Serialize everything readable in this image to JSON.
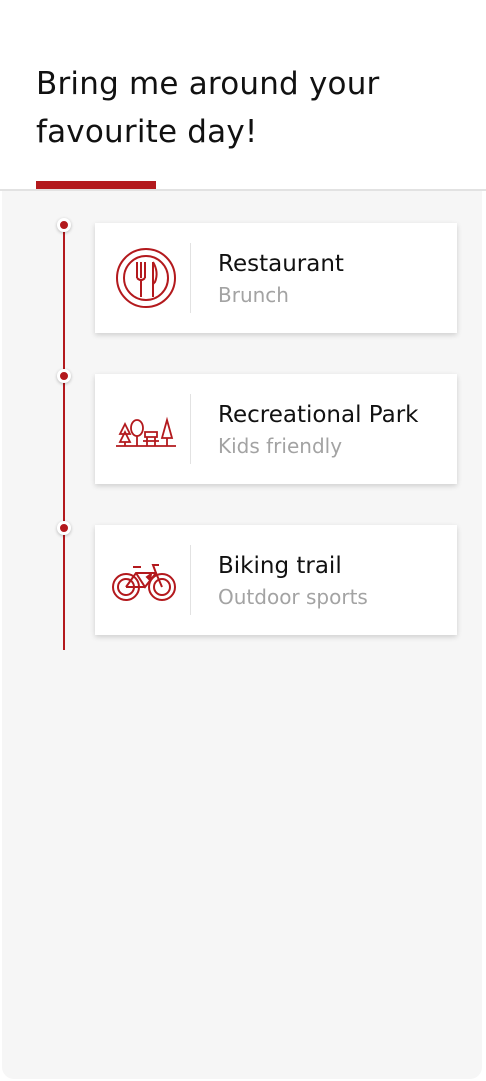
{
  "header": {
    "title": "Bring me around your\nfavourite day!"
  },
  "colors": {
    "accent": "#b3191d",
    "background": "#f6f6f6",
    "card": "#ffffff",
    "title_text": "#111111",
    "subtitle_text": "#a3a3a3"
  },
  "timeline": {
    "items": [
      {
        "icon": "restaurant-icon",
        "title": "Restaurant",
        "subtitle": "Brunch"
      },
      {
        "icon": "park-icon",
        "title": "Recreational Park",
        "subtitle": "Kids friendly"
      },
      {
        "icon": "bike-icon",
        "title": "Biking trail",
        "subtitle": "Outdoor sports"
      }
    ]
  }
}
